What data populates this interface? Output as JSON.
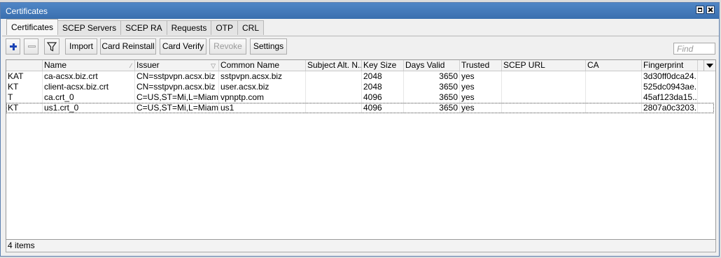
{
  "window": {
    "title": "Certificates"
  },
  "tabs": [
    "Certificates",
    "SCEP Servers",
    "SCEP RA",
    "Requests",
    "OTP",
    "CRL"
  ],
  "toolbar": {
    "import_label": "Import",
    "card_reinstall_label": "Card Reinstall",
    "card_verify_label": "Card Verify",
    "revoke_label": "Revoke",
    "settings_label": "Settings"
  },
  "search": {
    "placeholder": "Find"
  },
  "table": {
    "columns": [
      "Name",
      "Issuer",
      "Common Name",
      "Subject Alt. N...",
      "Key Size",
      "Days Valid",
      "Trusted",
      "SCEP URL",
      "CA",
      "Fingerprint"
    ],
    "rows": [
      {
        "flags": "KAT",
        "name": "ca-acsx.biz.crt",
        "issuer": "CN=sstpvpn.acsx.biz",
        "common_name": "sstpvpn.acsx.biz",
        "subject_alt": "",
        "key_size": "2048",
        "days_valid": "3650",
        "trusted": "yes",
        "scep_url": "",
        "ca": "",
        "fingerprint": "3d30ff0dca24..."
      },
      {
        "flags": "KT",
        "name": "client-acsx.biz.crt",
        "issuer": "CN=sstpvpn.acsx.biz",
        "common_name": "user.acsx.biz",
        "subject_alt": "",
        "key_size": "2048",
        "days_valid": "3650",
        "trusted": "yes",
        "scep_url": "",
        "ca": "",
        "fingerprint": "525dc0943ae..."
      },
      {
        "flags": "T",
        "name": "ca.crt_0",
        "issuer": "C=US,ST=Mi,L=Miami...",
        "common_name": "vpnptp.com",
        "subject_alt": "",
        "key_size": "4096",
        "days_valid": "3650",
        "trusted": "yes",
        "scep_url": "",
        "ca": "",
        "fingerprint": "45af123da15..."
      },
      {
        "flags": "KT",
        "name": "us1.crt_0",
        "issuer": "C=US,ST=Mi,L=Miami...",
        "common_name": "us1",
        "subject_alt": "",
        "key_size": "4096",
        "days_valid": "3650",
        "trusted": "yes",
        "scep_url": "",
        "ca": "",
        "fingerprint": "2807a0c3203..."
      }
    ]
  },
  "status": {
    "count_text": "4 items"
  }
}
